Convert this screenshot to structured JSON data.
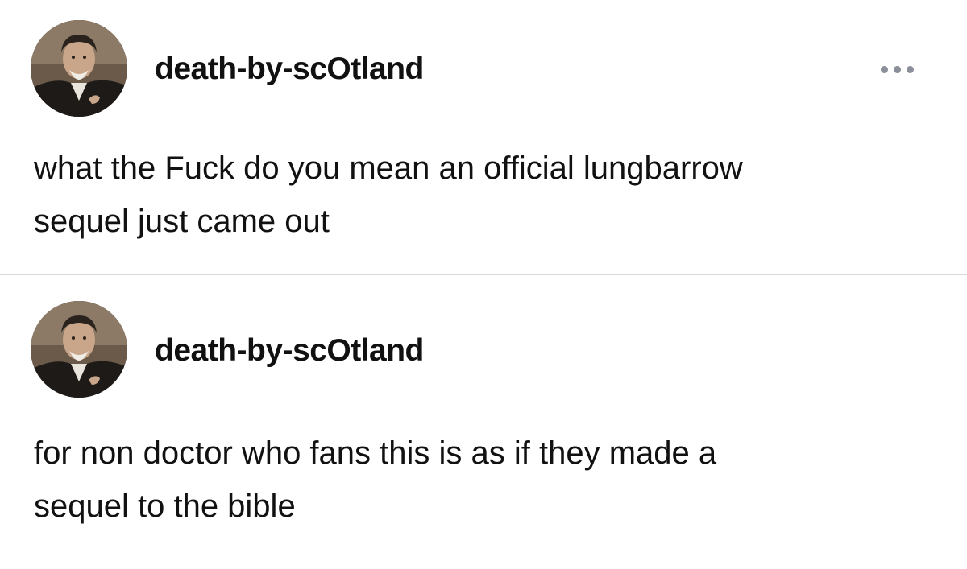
{
  "posts": [
    {
      "username": "death-by-scOtland",
      "text": "what the Fuck do you mean an official lungbarrow\nsequel just came out",
      "avatar_icon": "user-avatar-photo",
      "more_icon": "more-options-icon"
    },
    {
      "username": "death-by-scOtland",
      "text": "for non doctor who fans this is as if they made a\nsequel to the bible",
      "avatar_icon": "user-avatar-photo"
    }
  ],
  "colors": {
    "background": "#ffffff",
    "text": "#111111",
    "divider": "#d9d9d9",
    "more_dots": "#8a8f99"
  }
}
